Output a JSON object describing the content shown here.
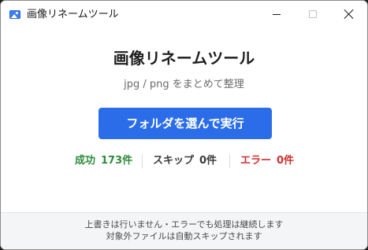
{
  "window": {
    "title": "画像リネームツール",
    "icon": "image-icon"
  },
  "main": {
    "heading": "画像リネームツール",
    "subtitle": "jpg / png をまとめて整理",
    "primary_button_label": "フォルダを選んで実行"
  },
  "stats": {
    "success": {
      "label": "成功",
      "value": "173件",
      "color": "#2e8b3a"
    },
    "skip": {
      "label": "スキップ",
      "value": "0件",
      "color": "#3a3a3a"
    },
    "error": {
      "label": "エラー",
      "value": "0件",
      "color": "#cf2e2e"
    }
  },
  "footer": {
    "line1": "上書きは行いません・エラーでも処理は継続します",
    "line2": "対象外ファイルは自動スキップされます"
  },
  "colors": {
    "accent": "#2b6de8",
    "footer_bg": "#f4f5f7"
  }
}
